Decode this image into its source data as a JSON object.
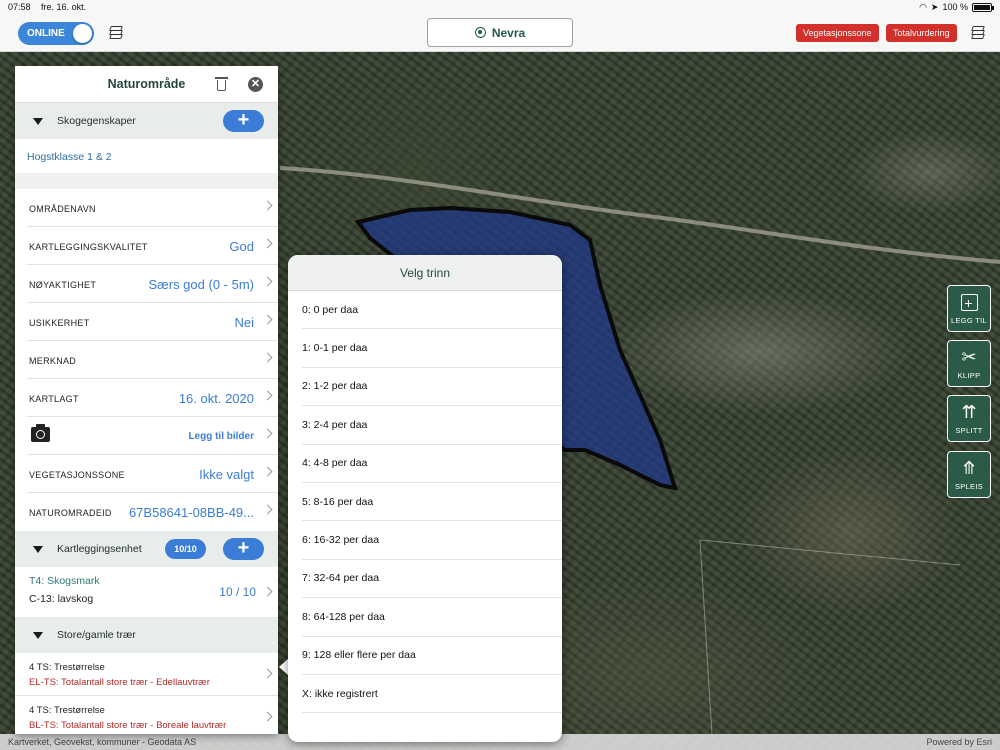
{
  "status_bar": {
    "time": "07:58",
    "date": "fre. 16. okt.",
    "battery": "100 %",
    "battery_level": 1.0
  },
  "toolbar": {
    "online_label": "ONLINE",
    "nevra_label": "Nevra",
    "vegetasjonssone_label": "Vegetasjonssone",
    "totalvurdering_label": "Totalvurdering"
  },
  "panel": {
    "title": "Naturområde",
    "skog_section": "Skogegenskaper",
    "hogstklasse": "Hogstklasse 1 & 2",
    "rows": [
      {
        "label": "OMRÅDENAVN",
        "value": ""
      },
      {
        "label": "KARTLEGGINGSKVALITET",
        "value": "God"
      },
      {
        "label": "NØYAKTIGHET",
        "value": "Særs god (0 - 5m)"
      },
      {
        "label": "USIKKERHET",
        "value": "Nei"
      },
      {
        "label": "MERKNAD",
        "value": ""
      },
      {
        "label": "KARTLAGT",
        "value": "16. okt. 2020"
      },
      {
        "label": "",
        "value": "Legg til bilder"
      },
      {
        "label": "VEGETASJONSSONE",
        "value": "Ikke valgt"
      },
      {
        "label": "NATUROMRADEID",
        "value": "67B58641-08BB-49..."
      }
    ],
    "kartlegging_section": "Kartleggingsenhet",
    "kartlegging_count": "10/10",
    "unit": {
      "line1": "T4: Skogsmark",
      "line2": "C-13: lavskog",
      "fraction": "10 / 10"
    },
    "trees_section": "Store/gamle trær",
    "trees": [
      {
        "line1": "4 TS: Trestørrelse",
        "line2": "EL-TS: Totalantall store trær - Edellauvtrær"
      },
      {
        "line1": "4 TS: Trestørrelse",
        "line2": "BL-TS: Totalantall store trær - Boreale lauvtrær"
      }
    ]
  },
  "popover": {
    "title": "Velg trinn",
    "items": [
      "0: 0 per daa",
      "1: 0-1 per daa",
      "2: 1-2 per daa",
      "3: 2-4 per daa",
      "4: 4-8 per daa",
      "5: 8-16 per daa",
      "6: 16-32 per daa",
      "7: 32-64 per daa",
      "8: 64-128 per daa",
      "9: 128 eller flere per daa",
      "X: ikke registrert"
    ]
  },
  "tools": {
    "add": "LEGG TIL",
    "clip": "KLIPP",
    "split": "SPLITT",
    "join": "SPLEIS"
  },
  "map": {
    "attribution_left": "Kartverket, Geovekst, kommuner - Geodata AS",
    "attribution_right": "Powered by Esri",
    "polygon_color": "#1f3a8a"
  }
}
